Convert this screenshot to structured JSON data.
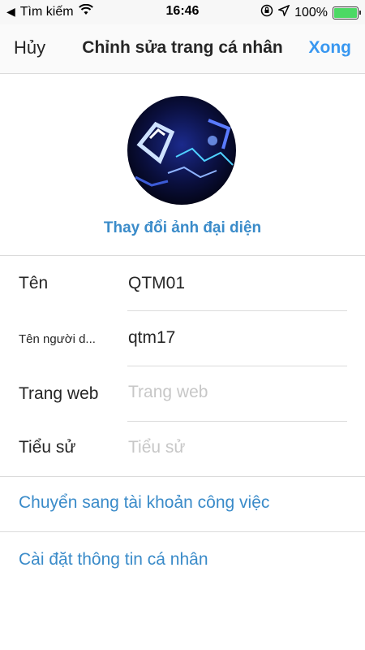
{
  "status": {
    "back_app": "Tìm kiếm",
    "time": "16:46",
    "battery_percent": "100%",
    "battery_level": 1.0
  },
  "nav": {
    "cancel": "Hủy",
    "title": "Chỉnh sửa trang cá nhân",
    "done": "Xong"
  },
  "profile": {
    "change_photo": "Thay đổi ảnh đại diện"
  },
  "fields": [
    {
      "label": "Tên",
      "value": "QTM01"
    },
    {
      "label": "Tên người d...",
      "value": "qtm17"
    },
    {
      "label": "Trang web",
      "placeholder": "Trang web"
    },
    {
      "label": "Tiểu sử",
      "placeholder": "Tiểu sử"
    }
  ],
  "links": {
    "business": "Chuyển sang tài khoản công việc",
    "personal_info": "Cài đặt thông tin cá nhân"
  },
  "colors": {
    "accent": "#3897f0",
    "link": "#3a8bc9",
    "divider": "#dbdbdb",
    "placeholder": "#c7c7c7"
  }
}
